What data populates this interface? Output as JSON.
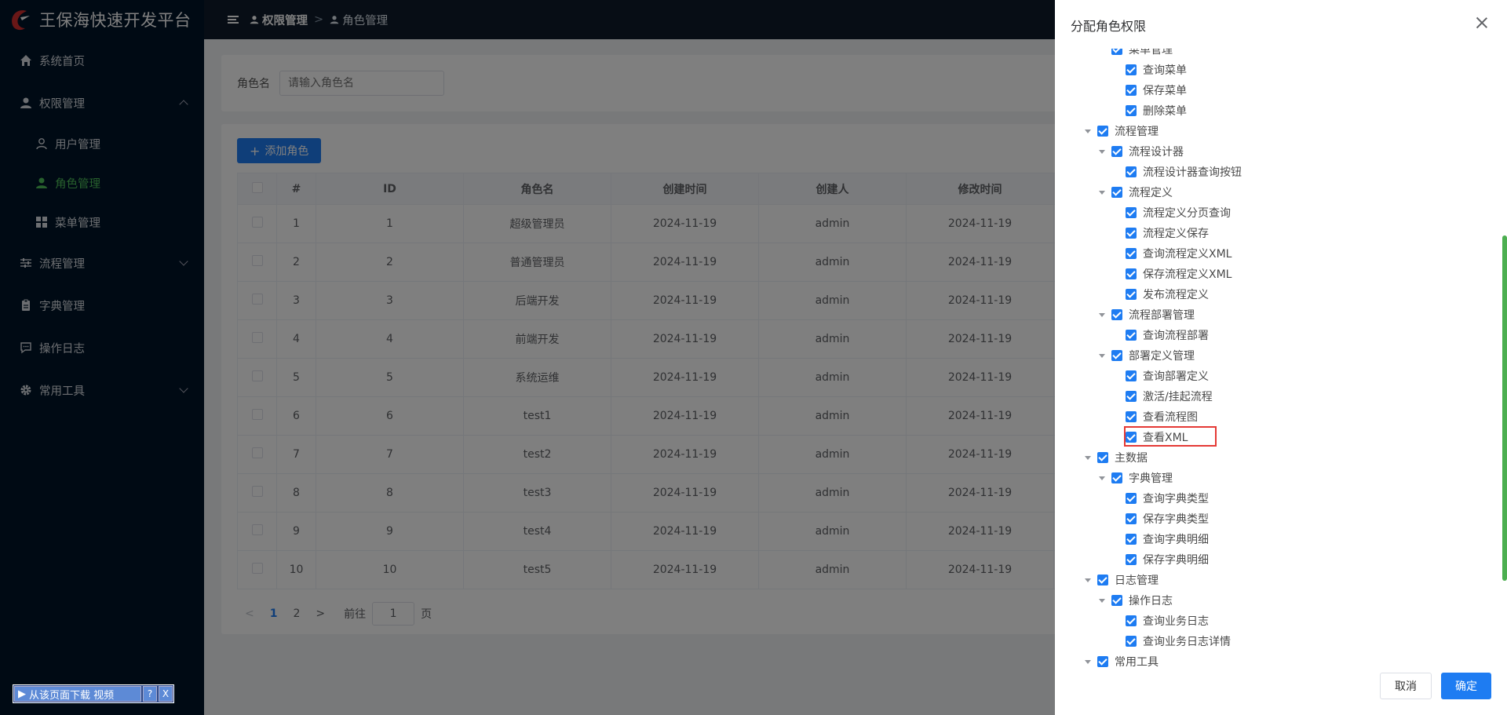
{
  "app": {
    "title": "王保海快速开发平台"
  },
  "sidebar": {
    "items": [
      {
        "label": "系统首页",
        "icon": "home-icon"
      },
      {
        "label": "权限管理",
        "icon": "user-icon",
        "expanded": true,
        "children": [
          {
            "label": "用户管理",
            "icon": "user-outline-icon"
          },
          {
            "label": "角色管理",
            "icon": "user-filled-icon",
            "active": true
          },
          {
            "label": "菜单管理",
            "icon": "grid-icon"
          }
        ]
      },
      {
        "label": "流程管理",
        "icon": "sliders-icon"
      },
      {
        "label": "字典管理",
        "icon": "clipboard-icon"
      },
      {
        "label": "操作日志",
        "icon": "chat-icon"
      },
      {
        "label": "常用工具",
        "icon": "gear-icon"
      }
    ]
  },
  "header": {
    "breadcrumb": [
      "权限管理",
      "角色管理"
    ]
  },
  "search": {
    "label": "角色名",
    "placeholder": "请输入角色名"
  },
  "table": {
    "add_label": "添加角色",
    "columns": [
      "#",
      "ID",
      "角色名",
      "创建时间",
      "创建人",
      "修改时间"
    ],
    "rows": [
      [
        "1",
        "1",
        "超级管理员",
        "2024-11-19",
        "admin",
        "2024-11-19"
      ],
      [
        "2",
        "2",
        "普通管理员",
        "2024-11-19",
        "admin",
        "2024-11-19"
      ],
      [
        "3",
        "3",
        "后端开发",
        "2024-11-19",
        "admin",
        "2024-11-19"
      ],
      [
        "4",
        "4",
        "前端开发",
        "2024-11-19",
        "admin",
        "2024-11-19"
      ],
      [
        "5",
        "5",
        "系统运维",
        "2024-11-19",
        "admin",
        "2024-11-19"
      ],
      [
        "6",
        "6",
        "test1",
        "2024-11-19",
        "admin",
        "2024-11-19"
      ],
      [
        "7",
        "7",
        "test2",
        "2024-11-19",
        "admin",
        "2024-11-19"
      ],
      [
        "8",
        "8",
        "test3",
        "2024-11-19",
        "admin",
        "2024-11-19"
      ],
      [
        "9",
        "9",
        "test4",
        "2024-11-19",
        "admin",
        "2024-11-19"
      ],
      [
        "10",
        "10",
        "test5",
        "2024-11-19",
        "admin",
        "2024-11-19"
      ]
    ]
  },
  "pagination": {
    "pages": [
      "1",
      "2"
    ],
    "current": "1",
    "goto_prefix": "前往",
    "goto_value": "1",
    "goto_suffix": "页"
  },
  "drawer": {
    "title": "分配角色权限",
    "cancel_label": "取消",
    "ok_label": "确定",
    "tree": [
      {
        "label": "菜单管理",
        "level": 1,
        "caret": false
      },
      {
        "label": "查询菜单",
        "level": 2,
        "caret": false
      },
      {
        "label": "保存菜单",
        "level": 2,
        "caret": false
      },
      {
        "label": "删除菜单",
        "level": 2,
        "caret": false
      },
      {
        "label": "流程管理",
        "level": 0,
        "caret": true
      },
      {
        "label": "流程设计器",
        "level": 1,
        "caret": true
      },
      {
        "label": "流程设计器查询按钮",
        "level": 2,
        "caret": false
      },
      {
        "label": "流程定义",
        "level": 1,
        "caret": true
      },
      {
        "label": "流程定义分页查询",
        "level": 2,
        "caret": false
      },
      {
        "label": "流程定义保存",
        "level": 2,
        "caret": false
      },
      {
        "label": "查询流程定义XML",
        "level": 2,
        "caret": false
      },
      {
        "label": "保存流程定义XML",
        "level": 2,
        "caret": false
      },
      {
        "label": "发布流程定义",
        "level": 2,
        "caret": false
      },
      {
        "label": "流程部署管理",
        "level": 1,
        "caret": true
      },
      {
        "label": "查询流程部署",
        "level": 2,
        "caret": false
      },
      {
        "label": "部署定义管理",
        "level": 1,
        "caret": true
      },
      {
        "label": "查询部署定义",
        "level": 2,
        "caret": false
      },
      {
        "label": "激活/挂起流程",
        "level": 2,
        "caret": false
      },
      {
        "label": "查看流程图",
        "level": 2,
        "caret": false
      },
      {
        "label": "查看XML",
        "level": 2,
        "caret": false,
        "highlighted": true
      },
      {
        "label": "主数据",
        "level": 0,
        "caret": true
      },
      {
        "label": "字典管理",
        "level": 1,
        "caret": true
      },
      {
        "label": "查询字典类型",
        "level": 2,
        "caret": false
      },
      {
        "label": "保存字典类型",
        "level": 2,
        "caret": false
      },
      {
        "label": "查询字典明细",
        "level": 2,
        "caret": false
      },
      {
        "label": "保存字典明细",
        "level": 2,
        "caret": false
      },
      {
        "label": "日志管理",
        "level": 0,
        "caret": true
      },
      {
        "label": "操作日志",
        "level": 1,
        "caret": true
      },
      {
        "label": "查询业务日志",
        "level": 2,
        "caret": false
      },
      {
        "label": "查询业务日志详情",
        "level": 2,
        "caret": false
      },
      {
        "label": "常用工具",
        "level": 0,
        "caret": true
      }
    ]
  },
  "download_widget": {
    "label": "从该页面下载 视频",
    "help": "?",
    "close": "X"
  },
  "colors": {
    "primary": "#1e7cf2",
    "active_menu": "#4fc05a",
    "sidebar_bg": "#001529",
    "highlight_border": "#e53935"
  }
}
